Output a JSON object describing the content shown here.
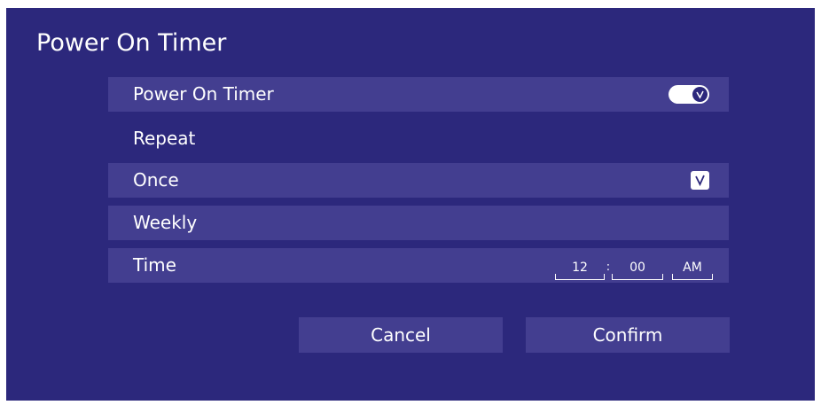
{
  "dialog": {
    "title": "Power On Timer"
  },
  "rows": {
    "power_on": {
      "label": "Power On Timer",
      "enabled": true,
      "icon": "check-icon"
    },
    "repeat": {
      "label": "Repeat"
    },
    "once": {
      "label": "Once",
      "checked": true,
      "icon": "check-icon"
    },
    "weekly": {
      "label": "Weekly"
    },
    "time": {
      "label": "Time",
      "hour": "12",
      "separator": ":",
      "minute": "00",
      "meridiem": "AM"
    }
  },
  "buttons": {
    "cancel": "Cancel",
    "confirm": "Confirm"
  },
  "colors": {
    "background": "#2c287c",
    "row_highlight": "#433e90",
    "text": "#ffffff"
  }
}
